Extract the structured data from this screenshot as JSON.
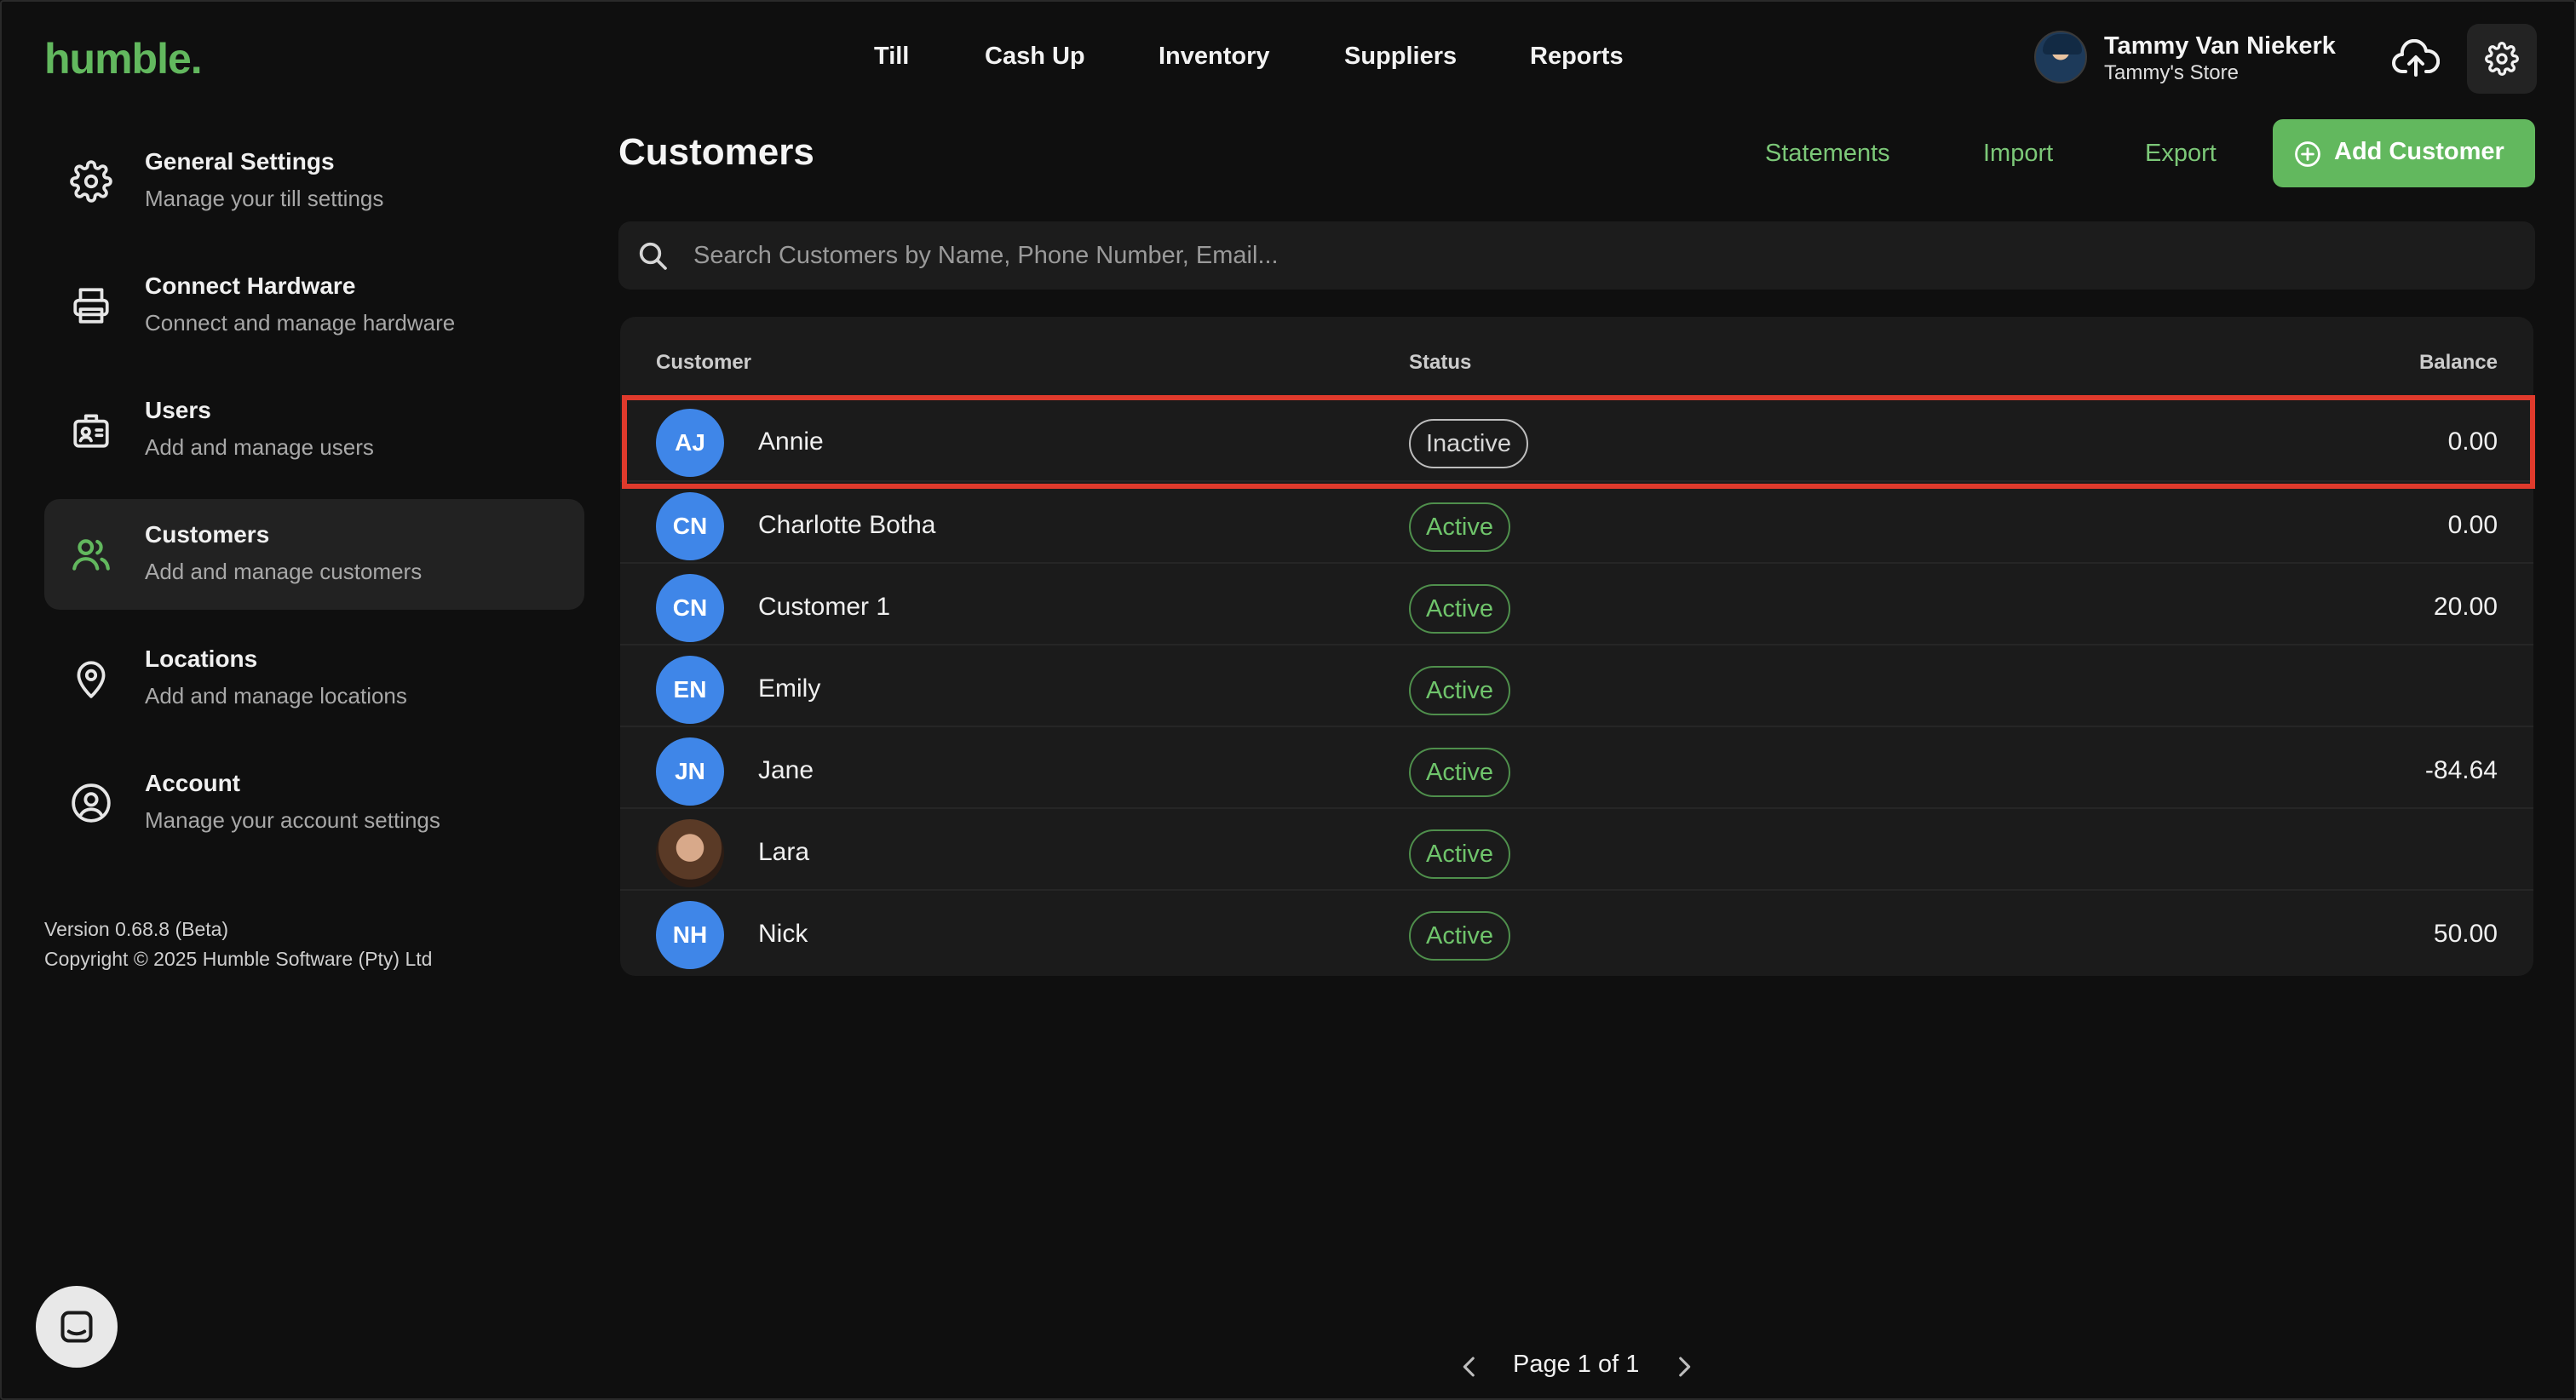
{
  "app": {
    "logo": "humble."
  },
  "topnav": [
    {
      "label": "Till"
    },
    {
      "label": "Cash Up"
    },
    {
      "label": "Inventory"
    },
    {
      "label": "Suppliers"
    },
    {
      "label": "Reports"
    }
  ],
  "user": {
    "name": "Tammy Van Niekerk",
    "store": "Tammy's Store"
  },
  "icons": {
    "cloud": "cloud-upload-icon",
    "settings": "gear-icon"
  },
  "sidebar": {
    "items": [
      {
        "title": "General Settings",
        "desc": "Manage your till settings",
        "icon": "gear-icon"
      },
      {
        "title": "Connect Hardware",
        "desc": "Connect and manage hardware",
        "icon": "printer-icon"
      },
      {
        "title": "Users",
        "desc": "Add and manage users",
        "icon": "id-card-icon"
      },
      {
        "title": "Customers",
        "desc": "Add and manage customers",
        "icon": "users-icon",
        "active": true
      },
      {
        "title": "Locations",
        "desc": "Add and manage locations",
        "icon": "location-pin-icon"
      },
      {
        "title": "Account",
        "desc": "Manage your account settings",
        "icon": "user-circle-icon"
      }
    ],
    "version": "Version 0.68.8 (Beta)",
    "copyright": "Copyright © 2025 Humble Software (Pty) Ltd"
  },
  "main": {
    "title": "Customers",
    "actions": {
      "statements": "Statements",
      "import": "Import",
      "export": "Export",
      "add": "Add Customer"
    },
    "search": {
      "placeholder": "Search Customers by Name, Phone Number, Email...",
      "value": ""
    },
    "table": {
      "headers": {
        "customer": "Customer",
        "status": "Status",
        "balance": "Balance"
      },
      "rows": [
        {
          "initials": "AJ",
          "name": "Annie",
          "status": "Inactive",
          "balance": "0.00",
          "photo": false
        },
        {
          "initials": "CN",
          "name": "Charlotte Botha",
          "status": "Active",
          "balance": "0.00",
          "photo": false
        },
        {
          "initials": "CN",
          "name": "Customer 1",
          "status": "Active",
          "balance": "20.00",
          "photo": false
        },
        {
          "initials": "EN",
          "name": "Emily",
          "status": "Active",
          "balance": "",
          "photo": false
        },
        {
          "initials": "JN",
          "name": "Jane",
          "status": "Active",
          "balance": "-84.64",
          "photo": false
        },
        {
          "initials": "",
          "name": "Lara",
          "status": "Active",
          "balance": "",
          "photo": true
        },
        {
          "initials": "NH",
          "name": "Nick",
          "status": "Active",
          "balance": "50.00",
          "photo": false
        }
      ]
    },
    "pagination": {
      "label": "Page 1 of 1"
    }
  },
  "colors": {
    "accent": "#62b85e",
    "avatar": "#3f86e8",
    "highlight": "#e03a2c"
  }
}
